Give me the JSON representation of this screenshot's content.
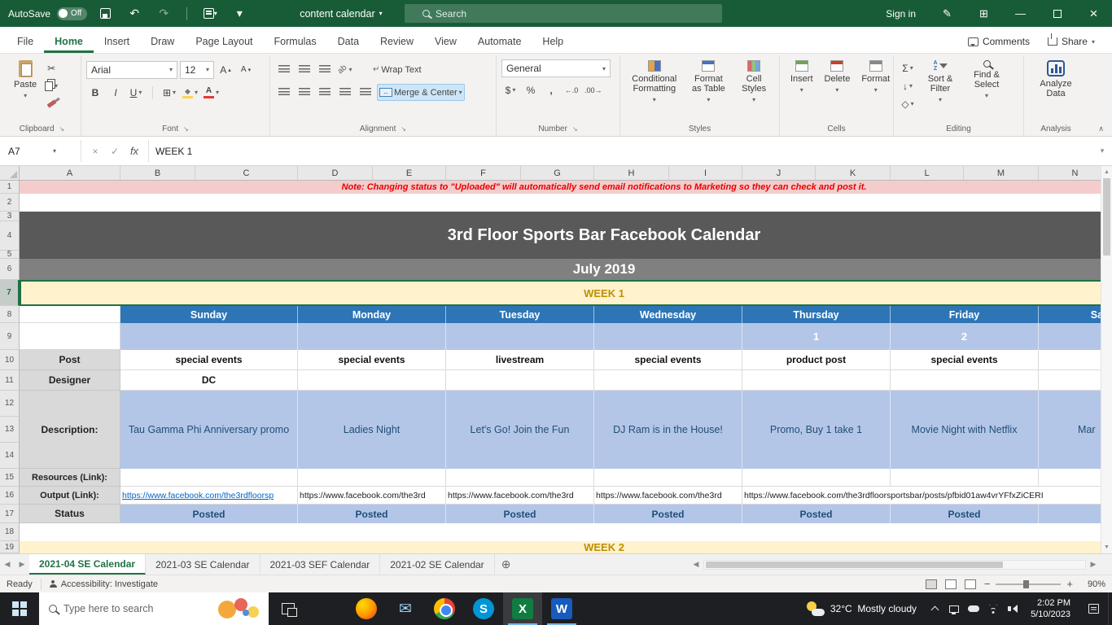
{
  "icons": {
    "chevron_down": "▾",
    "caret_up": "∧",
    "scissors": "✂",
    "undo": "↶",
    "redo": "↷",
    "pen": "✎",
    "grid": "⊞",
    "close": "×",
    "minimize": "—",
    "check": "✓",
    "cancel": "×",
    "fx": "fx",
    "bold": "B",
    "italic": "I",
    "underline": "U",
    "letter_a": "A",
    "up_small": "▴",
    "down_small": "▾",
    "borders": "⊞",
    "fill_diamond": "◆",
    "ab": "ab",
    "return_arrow": "↵",
    "merge_arrows": "↔",
    "dollar": "$",
    "percent": "%",
    "comma": ",",
    "dec_increase": "←.0",
    "dec_decrease": ".00→",
    "sum": "Σ",
    "fill_down": "↓",
    "clear": "◇",
    "arrow_se": "↘",
    "left_arrow": "◀",
    "right_arrow": "▶",
    "up_arrow": "▲",
    "down_arrow": "▼",
    "plus_circle": "⊕",
    "minus": "−",
    "plus": "+",
    "mail": "✉",
    "skype_s": "S",
    "excel_x": "X",
    "word_w": "W",
    "az_a": "A",
    "az_z": "Z"
  },
  "titlebar": {
    "autosave_label": "AutoSave",
    "autosave_state": "Off",
    "doc_title": "content calendar",
    "search_placeholder": "Search",
    "sign_in": "Sign in"
  },
  "ribbon_tabs": {
    "items": [
      "File",
      "Home",
      "Insert",
      "Draw",
      "Page Layout",
      "Formulas",
      "Data",
      "Review",
      "View",
      "Automate",
      "Help"
    ],
    "comments": "Comments",
    "share": "Share"
  },
  "ribbon": {
    "paste_label": "Paste",
    "clipboard_group": "Clipboard",
    "font_name": "Arial",
    "font_size": "12",
    "font_group": "Font",
    "wrap_text": "Wrap Text",
    "merge_center": "Merge & Center",
    "alignment_group": "Alignment",
    "number_format": "General",
    "number_group": "Number",
    "conditional_formatting": "Conditional Formatting",
    "format_as_table": "Format as Table",
    "cell_styles": "Cell Styles",
    "styles_group": "Styles",
    "insert": "Insert",
    "delete": "Delete",
    "format": "Format",
    "cells_group": "Cells",
    "sort_filter": "Sort & Filter",
    "find_select": "Find & Select",
    "editing_group": "Editing",
    "analyze_data": "Analyze Data",
    "analysis_group": "Analysis"
  },
  "formula_bar": {
    "name_box": "A7",
    "value": "WEEK 1"
  },
  "grid": {
    "col_headers": [
      "A",
      "B",
      "C",
      "D",
      "E",
      "F",
      "G",
      "H",
      "I",
      "J",
      "K",
      "L",
      "M",
      "N"
    ],
    "row_numbers": [
      "1",
      "2",
      "3",
      "4",
      "5",
      "6",
      "7",
      "8",
      "9",
      "10",
      "11",
      "12",
      "13",
      "14",
      "15",
      "16",
      "17",
      "18",
      "19"
    ],
    "note": "Note: Changing status to \"Uploaded\" will automatically send email notifications to Marketing so they can check and post it.",
    "calendar_title": "3rd Floor Sports Bar Facebook Calendar",
    "month_title": "July 2019",
    "week1_label": "WEEK 1",
    "week2_label": "WEEK 2",
    "days": [
      "Sunday",
      "Monday",
      "Tuesday",
      "Wednesday",
      "Thursday",
      "Friday",
      "Saturday"
    ],
    "dates": [
      "",
      "",
      "",
      "",
      "1",
      "2",
      ""
    ],
    "row_labels": {
      "post": "Post",
      "designer": "Designer",
      "description": "Description:",
      "resources": "Resources (Link):",
      "output": "Output (Link):",
      "status": "Status"
    },
    "post_values": [
      "special events",
      "special events",
      "livestream",
      "special events",
      "product post",
      "special events",
      ""
    ],
    "designer_values": [
      "DC",
      "",
      "",
      "",
      "",
      "",
      ""
    ],
    "descriptions": [
      "Tau Gamma Phi Anniversary promo",
      "Ladies Night",
      "Let's Go! Join the Fun",
      "DJ Ram is in the House!",
      "Promo, Buy 1 take 1",
      "Movie Night with Netflix",
      "Mar"
    ],
    "output_links": [
      "https://www.facebook.com/the3rdfloorsp",
      "https://www.facebook.com/the3rd",
      "https://www.facebook.com/the3rd",
      "https://www.facebook.com/the3rd",
      "https://www.facebook.com/the3rdfloorsportsbar/posts/pfbid01aw4vrYFfxZiCERI"
    ],
    "status_values": [
      "Posted",
      "Posted",
      "Posted",
      "Posted",
      "Posted",
      "Posted",
      ""
    ]
  },
  "sheet_tabs": {
    "items": [
      "2021-04 SE Calendar",
      "2021-03 SE Calendar",
      "2021-03 SEF Calendar",
      "2021-02 SE Calendar"
    ]
  },
  "status_bar": {
    "ready": "Ready",
    "accessibility": "Accessibility: Investigate",
    "zoom": "90%"
  },
  "taskbar": {
    "search_placeholder": "Type here to search",
    "weather_temp": "32°C",
    "weather_desc": "Mostly cloudy",
    "time": "2:02 PM",
    "date": "5/10/2023"
  }
}
